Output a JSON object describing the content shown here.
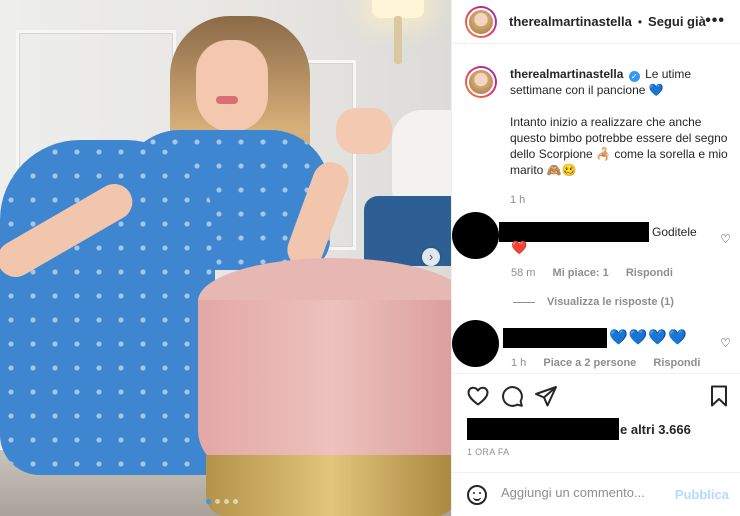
{
  "header": {
    "username": "therealmartinastella",
    "separator": "•",
    "follow_label": "Segui già",
    "more_label": "•••"
  },
  "caption": {
    "username": "therealmartinastella",
    "verified_glyph": "✓",
    "line1": "Le utime settimane con il pancione 💙",
    "line2": "Intanto inizio a realizzare che anche questo bimbo potrebbe essere del segno dello Scorpione 🦂 come la sorella e mio marito 🙈🥴",
    "time": "1 h"
  },
  "comments": [
    {
      "text": "Goditele",
      "emoji": "❤️",
      "time": "58 m",
      "likes": "Mi piace: 1",
      "reply": "Rispondi"
    },
    {
      "text": "💙💙💙💙",
      "time": "1 h",
      "likes": "Piace a 2 persone",
      "reply": "Rispondi"
    }
  ],
  "replies_label": "Visualizza le risposte (1)",
  "likes_text": "e altri 3.666",
  "posted_time": "1 ORA FA",
  "add_comment": {
    "placeholder": "Aggiungi un commento...",
    "publish_label": "Pubblica"
  },
  "carousel": {
    "next_glyph": "›",
    "count": 4,
    "active_index": 0
  },
  "colors": {
    "accent": "#3897f0",
    "heart": "#e3213a",
    "publish_disabled": "#b3dbff",
    "meta_gray": "#8e8e8e"
  }
}
